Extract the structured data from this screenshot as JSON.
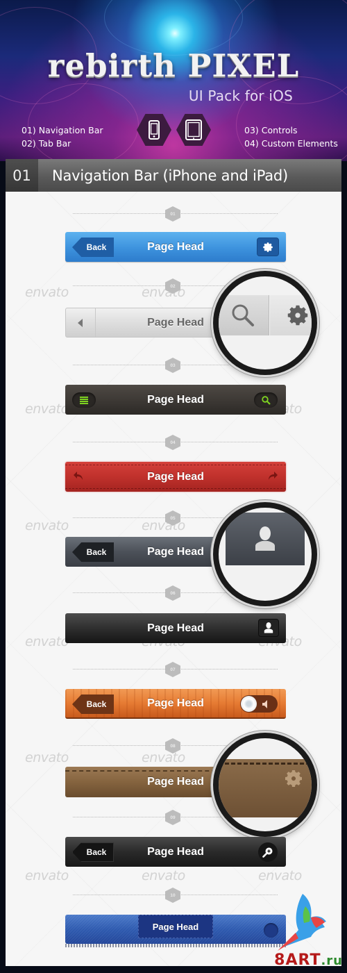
{
  "hero": {
    "title": "rebirth PIXEL",
    "subtitle": "UI Pack for iOS",
    "features_left": [
      "01) Navigation Bar",
      "02) Tab Bar"
    ],
    "features_right": [
      "03) Controls",
      "04) Custom Elements"
    ],
    "device_icons": [
      "iphone-icon",
      "ipad-icon"
    ]
  },
  "section": {
    "number": "01",
    "title": "Navigation Bar (iPhone and iPad)"
  },
  "watermark_text": "envato",
  "steps": [
    "01",
    "02",
    "03",
    "04",
    "05",
    "06",
    "07",
    "08",
    "09",
    "10"
  ],
  "navbars": [
    {
      "style": "blue",
      "title": "Page Head",
      "back_label": "Back",
      "right_icon": "gear-icon",
      "color": "#3d92dd"
    },
    {
      "style": "light-gray",
      "title": "Page Head",
      "left_icon": "chevron-left-icon",
      "right_icons": [
        "search-icon",
        "gear-icon"
      ],
      "color": "#dedede"
    },
    {
      "style": "dark-brown",
      "title": "Page Head",
      "left_icon": "list-icon",
      "right_icon": "search-icon",
      "accent": "#7ed321",
      "color": "#3c3834"
    },
    {
      "style": "red-leather",
      "title": "Page Head",
      "left_icon": "reply-icon",
      "right_icon": "forward-icon",
      "color": "#c0312c"
    },
    {
      "style": "slate",
      "title": "Page Head",
      "back_label": "Back",
      "right_icon": "user-icon",
      "color": "#4c5159"
    },
    {
      "style": "black",
      "title": "Page Head",
      "right_icon": "user-icon",
      "color": "#2f2f2f"
    },
    {
      "style": "wood",
      "title": "Page Head",
      "back_label": "Back",
      "right_icon": "sound-toggle-icon",
      "color": "#e67b33"
    },
    {
      "style": "brown-leather",
      "title": "Page Head",
      "right_icon": "gear-icon",
      "color": "#85643f"
    },
    {
      "style": "charcoal",
      "title": "Page Head",
      "back_label": "Back",
      "right_icon": "zoom-in-icon",
      "color": "#2a2a2a"
    },
    {
      "style": "denim",
      "title": "Page Head",
      "right_icon": "button-icon",
      "color": "#2f5bb0"
    }
  ],
  "site_logo": {
    "main": "8ART",
    "suffix": ".ru"
  }
}
